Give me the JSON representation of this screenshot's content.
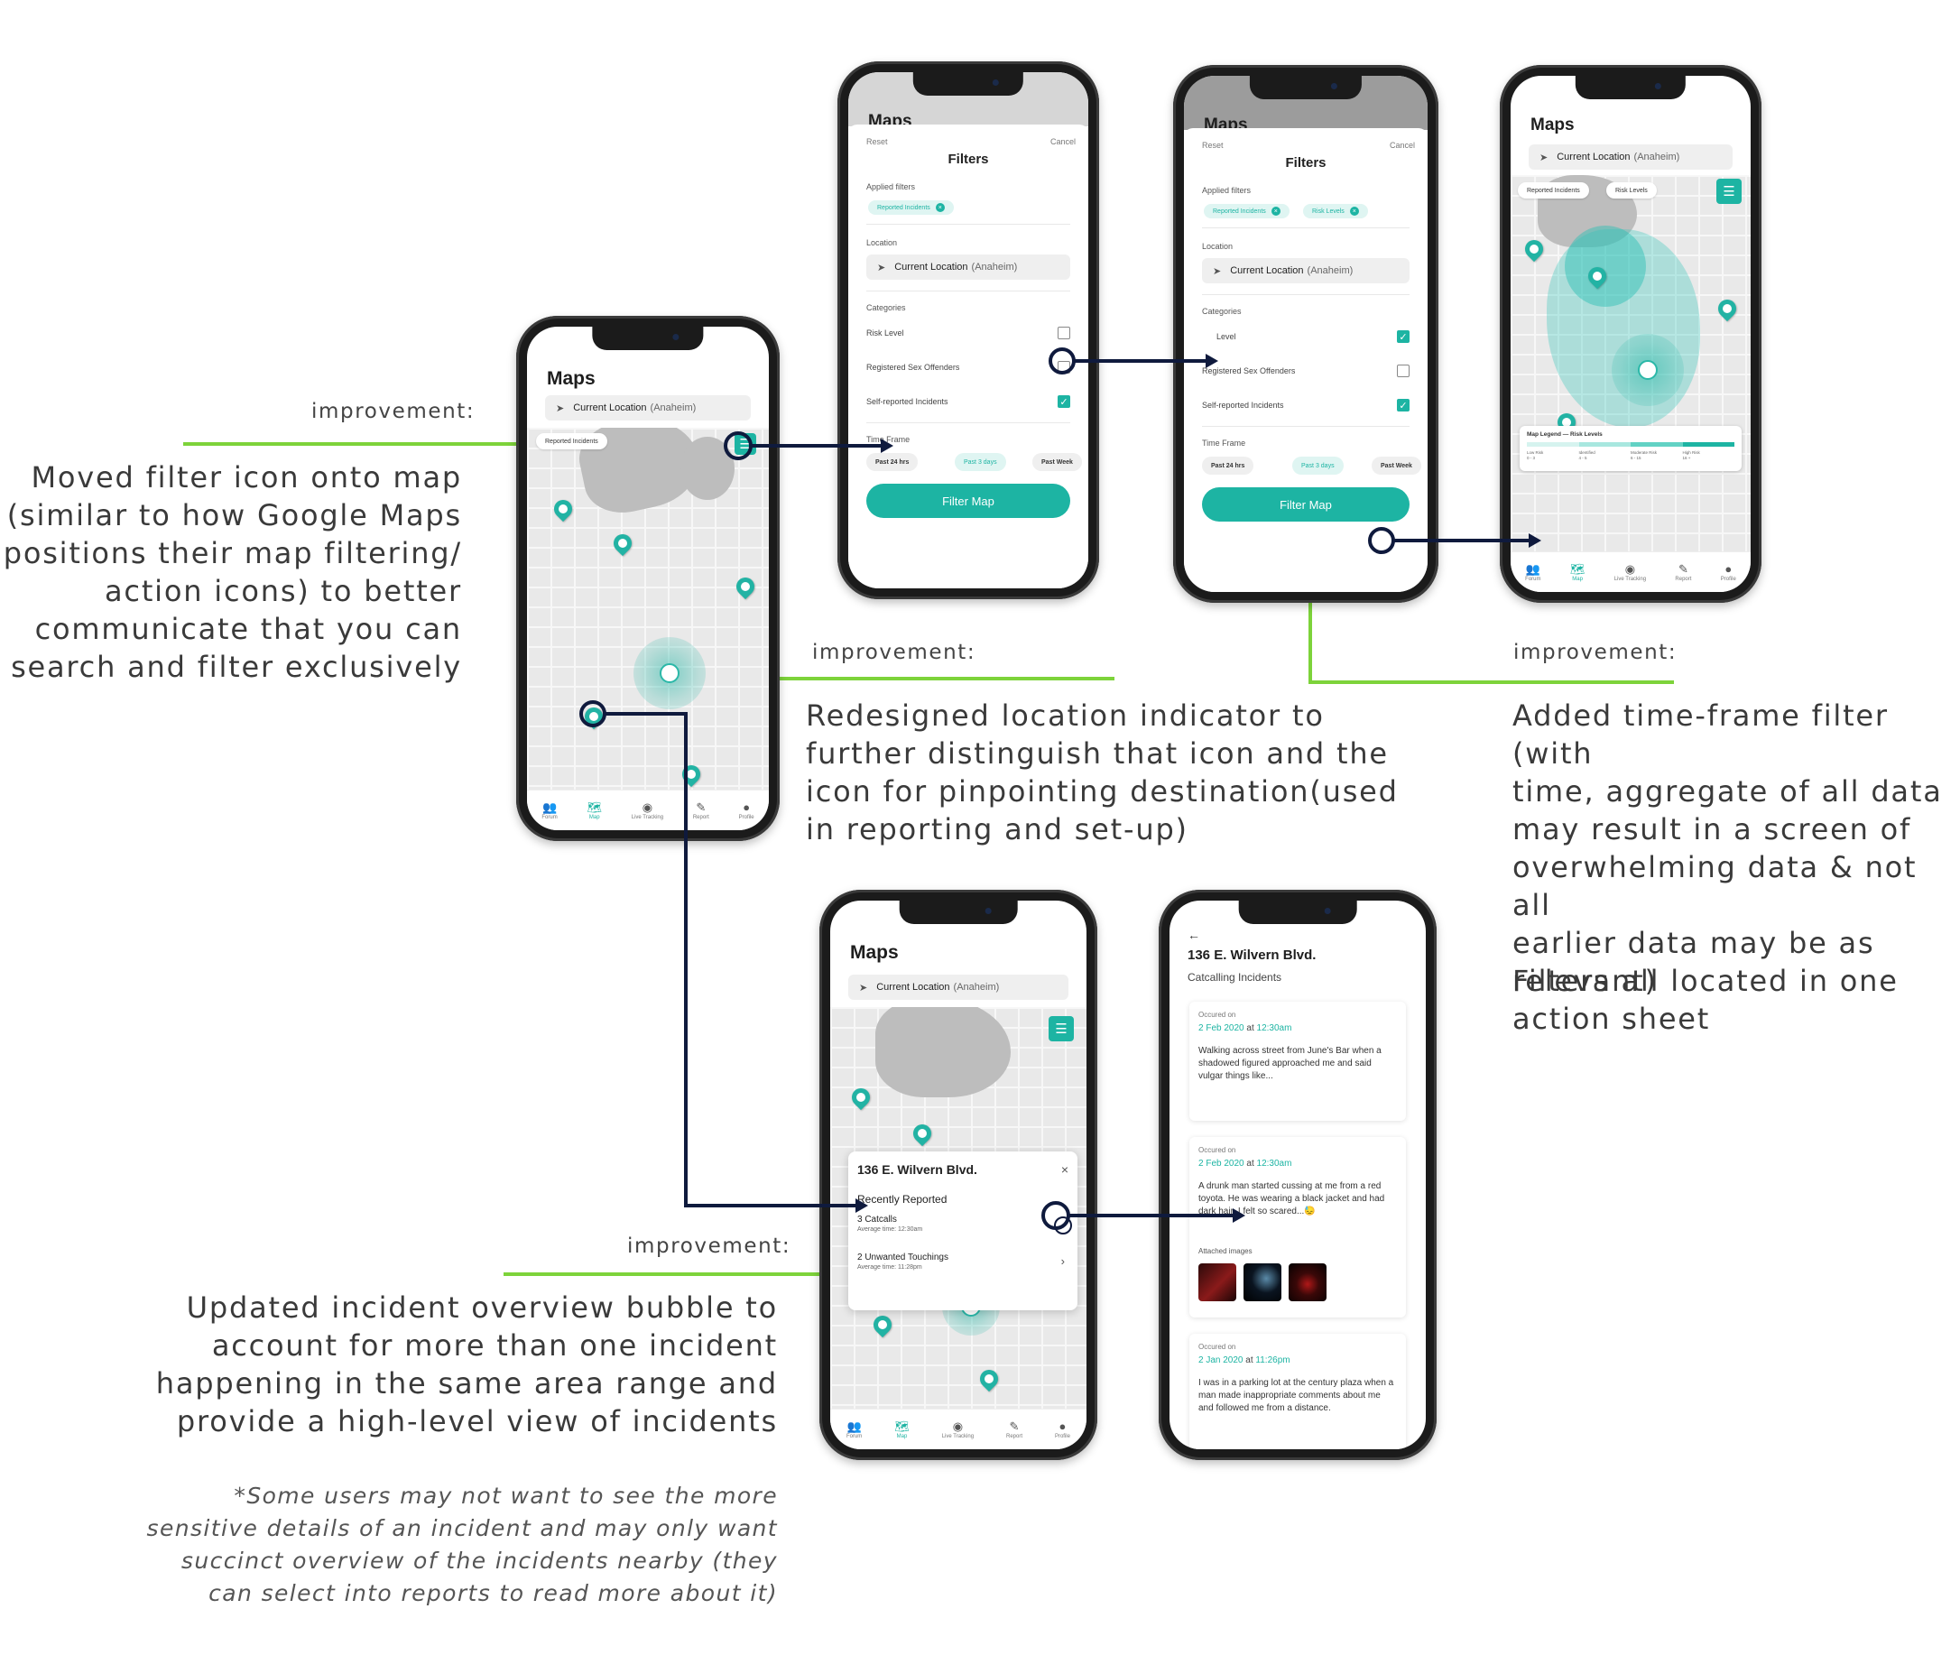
{
  "colors": {
    "accent": "#1db4a3",
    "green_line": "#7dd33a",
    "connector": "#0f1a3d"
  },
  "annotations": {
    "a1": {
      "label": "improvement:",
      "text": "Moved filter icon onto map\n(similar to how Google Maps\npositions their  map filtering/\naction icons) to better\ncommunicate that you can\nsearch and filter exclusively"
    },
    "a2": {
      "label": "improvement:",
      "text": "Redesigned location indicator to\nfurther distinguish that icon and the\nicon for pinpointing destination(used\nin reporting and set-up)"
    },
    "a3": {
      "label": "improvement:",
      "text": "Added time-frame filter (with\ntime, aggregate of all data\nmay result in a screen of\noverwhelming data & not all\nearlier data may be as\nrelevant)",
      "text2": "Filters all located in one\naction sheet"
    },
    "a4": {
      "label": "improvement:",
      "text": "Updated incident overview bubble to\naccount for more than one incident\nhappening in the same area range and\nprovide a high-level view of incidents",
      "note": "*Some users may not want to see the more\nsensitive details of an incident and may only want\nsuccinct overview of the incidents nearby (they\ncan select into reports to read more about it)"
    }
  },
  "common": {
    "maps_title": "Maps",
    "current_location": "Current Location",
    "location_city": "(Anaheim)",
    "tabs": [
      {
        "label": "Forum",
        "icon": "forum-icon"
      },
      {
        "label": "Map",
        "icon": "map-icon"
      },
      {
        "label": "Live Tracking",
        "icon": "live-tracking-icon"
      },
      {
        "label": "Report",
        "icon": "pencil-icon"
      },
      {
        "label": "Profile",
        "icon": "profile-icon"
      }
    ]
  },
  "phone1": {
    "chip": "Reported Incidents"
  },
  "filters": {
    "reset": "Reset",
    "cancel": "Cancel",
    "title": "Filters",
    "applied_label": "Applied filters",
    "applied": [
      "Reported Incidents",
      "Risk Levels"
    ],
    "location_label": "Location",
    "categories_label": "Categories",
    "categories": [
      "Risk Level",
      "Registered Sex Offenders",
      "Self-reported Incidents"
    ],
    "categories_p3_first": "Level",
    "time_frame_label": "Time Frame",
    "time_frames": [
      "Past 24 hrs",
      "Past 3 days",
      "Past Week"
    ],
    "button": "Filter Map"
  },
  "phone4": {
    "chips": [
      "Reported Incidents",
      "Risk Levels"
    ],
    "legend_title": "Map Legend — Risk Levels",
    "legend_levels": [
      {
        "label": "Low Risk",
        "range": "0 - 3"
      },
      {
        "label": "Identified",
        "range": "4 - 5"
      },
      {
        "label": "Moderate Risk",
        "range": "6 - 15"
      },
      {
        "label": "High Risk",
        "range": "16 +"
      }
    ]
  },
  "bubble": {
    "title": "136 E. Wilvern Blvd.",
    "subtitle": "Recently Reported",
    "items": [
      {
        "title": "3 Catcalls",
        "sub": "Average time: 12:30am"
      },
      {
        "title": "2 Unwanted Touchings",
        "sub": "Average time: 11:28pm"
      }
    ]
  },
  "report": {
    "title": "136 E. Wilvern Blvd.",
    "subtitle": "Catcalling Incidents",
    "occurred_label": "Occured on",
    "at": "at",
    "attached_label": "Attached images",
    "cards": [
      {
        "date": "2 Feb 2020",
        "time": "12:30am",
        "text": "Walking across street from June's Bar when a shadowed figured approached me and said vulgar things like..."
      },
      {
        "date": "2 Feb 2020",
        "time": "12:30am",
        "text": "A drunk man started cussing at me from a red toyota. He was wearing a black jacket and had dark hair. I felt so scared...😓"
      },
      {
        "date": "2 Jan 2020",
        "time": "11:26pm",
        "text": "I was in a parking lot at the century plaza when a man made inappropriate comments about me and followed me from a distance."
      }
    ]
  }
}
